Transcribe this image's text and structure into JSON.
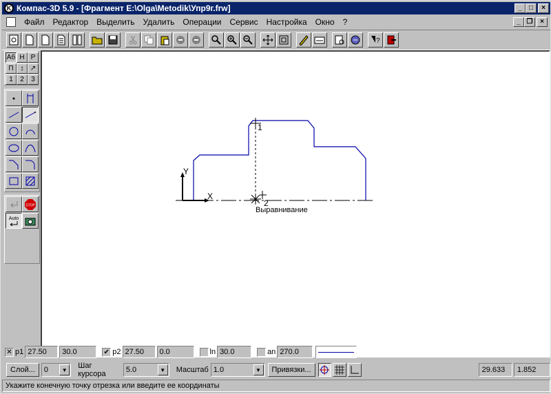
{
  "window": {
    "title": "Компас-3D 5.9 - [Фрагмент E:\\Olga\\Metodik\\Упр9г.frw]",
    "caption_buttons": [
      "minimize",
      "maximize",
      "close"
    ]
  },
  "menu": {
    "items": [
      {
        "label": "Файл"
      },
      {
        "label": "Редактор"
      },
      {
        "label": "Выделить"
      },
      {
        "label": "Удалить"
      },
      {
        "label": "Операции"
      },
      {
        "label": "Сервис"
      },
      {
        "label": "Настройка"
      },
      {
        "label": "Окно"
      },
      {
        "label": "?"
      }
    ]
  },
  "toolbar": {
    "icons": [
      "new-drawing-icon",
      "new-doc-icon",
      "new-sheet-icon",
      "new-spec-icon",
      "new-text-icon",
      "open-icon",
      "save-icon",
      "cut-icon",
      "copy-icon",
      "paste-icon",
      "undo-icon",
      "redo-icon",
      "zoom-window-icon",
      "zoom-in-icon",
      "zoom-out-icon",
      "pan-icon",
      "zoom-fit-icon",
      "draw-style-icon",
      "layers-icon",
      "properties-icon",
      "library-icon",
      "help-icon",
      "exit-icon"
    ]
  },
  "left_panel": {
    "tab_row1": [
      "Аб",
      "Н",
      "Р"
    ],
    "tab_row2": [
      "П",
      "↕",
      "↗"
    ],
    "tab_row3": [
      "1",
      "2",
      "3"
    ],
    "tools": [
      "point-icon",
      "aux-line-icon",
      "segment-icon",
      "parallel-segment-icon",
      "circle-icon",
      "arc-icon",
      "ellipse-icon",
      "bezier-icon",
      "chamfer-icon",
      "fillet-icon",
      "rectangle-icon",
      "hatch-icon"
    ],
    "control": [
      "enter-icon",
      "stop-icon",
      "auto-icon",
      "snapshot-icon"
    ],
    "stop_label": "STOP",
    "auto_label": "Auto"
  },
  "canvas": {
    "point1_label": "1",
    "point2_label": "2",
    "axis_x_label": "X",
    "axis_y_label": "Y",
    "snap_hint": "Выравнивание"
  },
  "coordbar": {
    "p1_label": "p1",
    "p1_x": "27.50",
    "p1_y": "30.0",
    "p2_label": "p2",
    "p2_x": "27.50",
    "p2_y": "0.0",
    "ln_label": "ln",
    "ln_value": "30.0",
    "an_label": "an",
    "an_value": "270.0"
  },
  "parambar": {
    "layer_button": "Слой...",
    "layer_value": "0",
    "cursor_step_label": "Шаг курсора",
    "cursor_step_value": "5.0",
    "scale_label": "Масштаб",
    "scale_value": "1.0",
    "snaps_button": "Привязки...",
    "coord_x": "29.633",
    "coord_y": "1.852"
  },
  "status": {
    "message": "Укажите конечную точку отрезка или введите ее координаты"
  },
  "colors": {
    "title_bg": "#0a246a",
    "geometry": "#0000a8",
    "face": "#c0c0c0"
  }
}
